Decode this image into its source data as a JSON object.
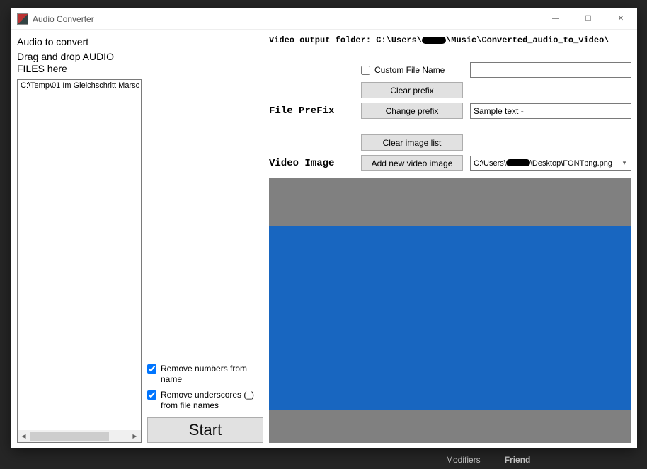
{
  "window": {
    "title": "Audio Converter",
    "buttons": {
      "min": "—",
      "max": "☐",
      "close": "✕"
    }
  },
  "background": {
    "label_left": "Modifiers",
    "label_right": "Friend"
  },
  "left": {
    "heading1": "Audio to convert",
    "heading2": "Drag and drop AUDIO FILES here",
    "items": [
      "C:\\Temp\\01 Im Gleichschritt Marsc"
    ]
  },
  "options": {
    "remove_numbers_label": "Remove numbers from name",
    "remove_numbers_checked": true,
    "remove_underscores_label": "Remove underscores (_) from file names",
    "remove_underscores_checked": true,
    "start_label": "Start"
  },
  "right": {
    "output_prefix": "Video output folder: C:\\Users\\",
    "output_suffix": "\\Music\\Converted_audio_to_video\\",
    "custom_filename_label": "Custom File Name",
    "custom_filename_checked": false,
    "custom_filename_value": "",
    "clear_prefix_label": "Clear prefix",
    "file_prefix_label": "File PreFix",
    "change_prefix_label": "Change prefix",
    "prefix_value": "Sample text - ",
    "clear_image_list_label": "Clear image list",
    "video_image_label": "Video Image",
    "add_image_label": "Add new video image",
    "image_combo_prefix": "C:\\Users\\",
    "image_combo_suffix": "\\Desktop\\FONTpng.png"
  }
}
